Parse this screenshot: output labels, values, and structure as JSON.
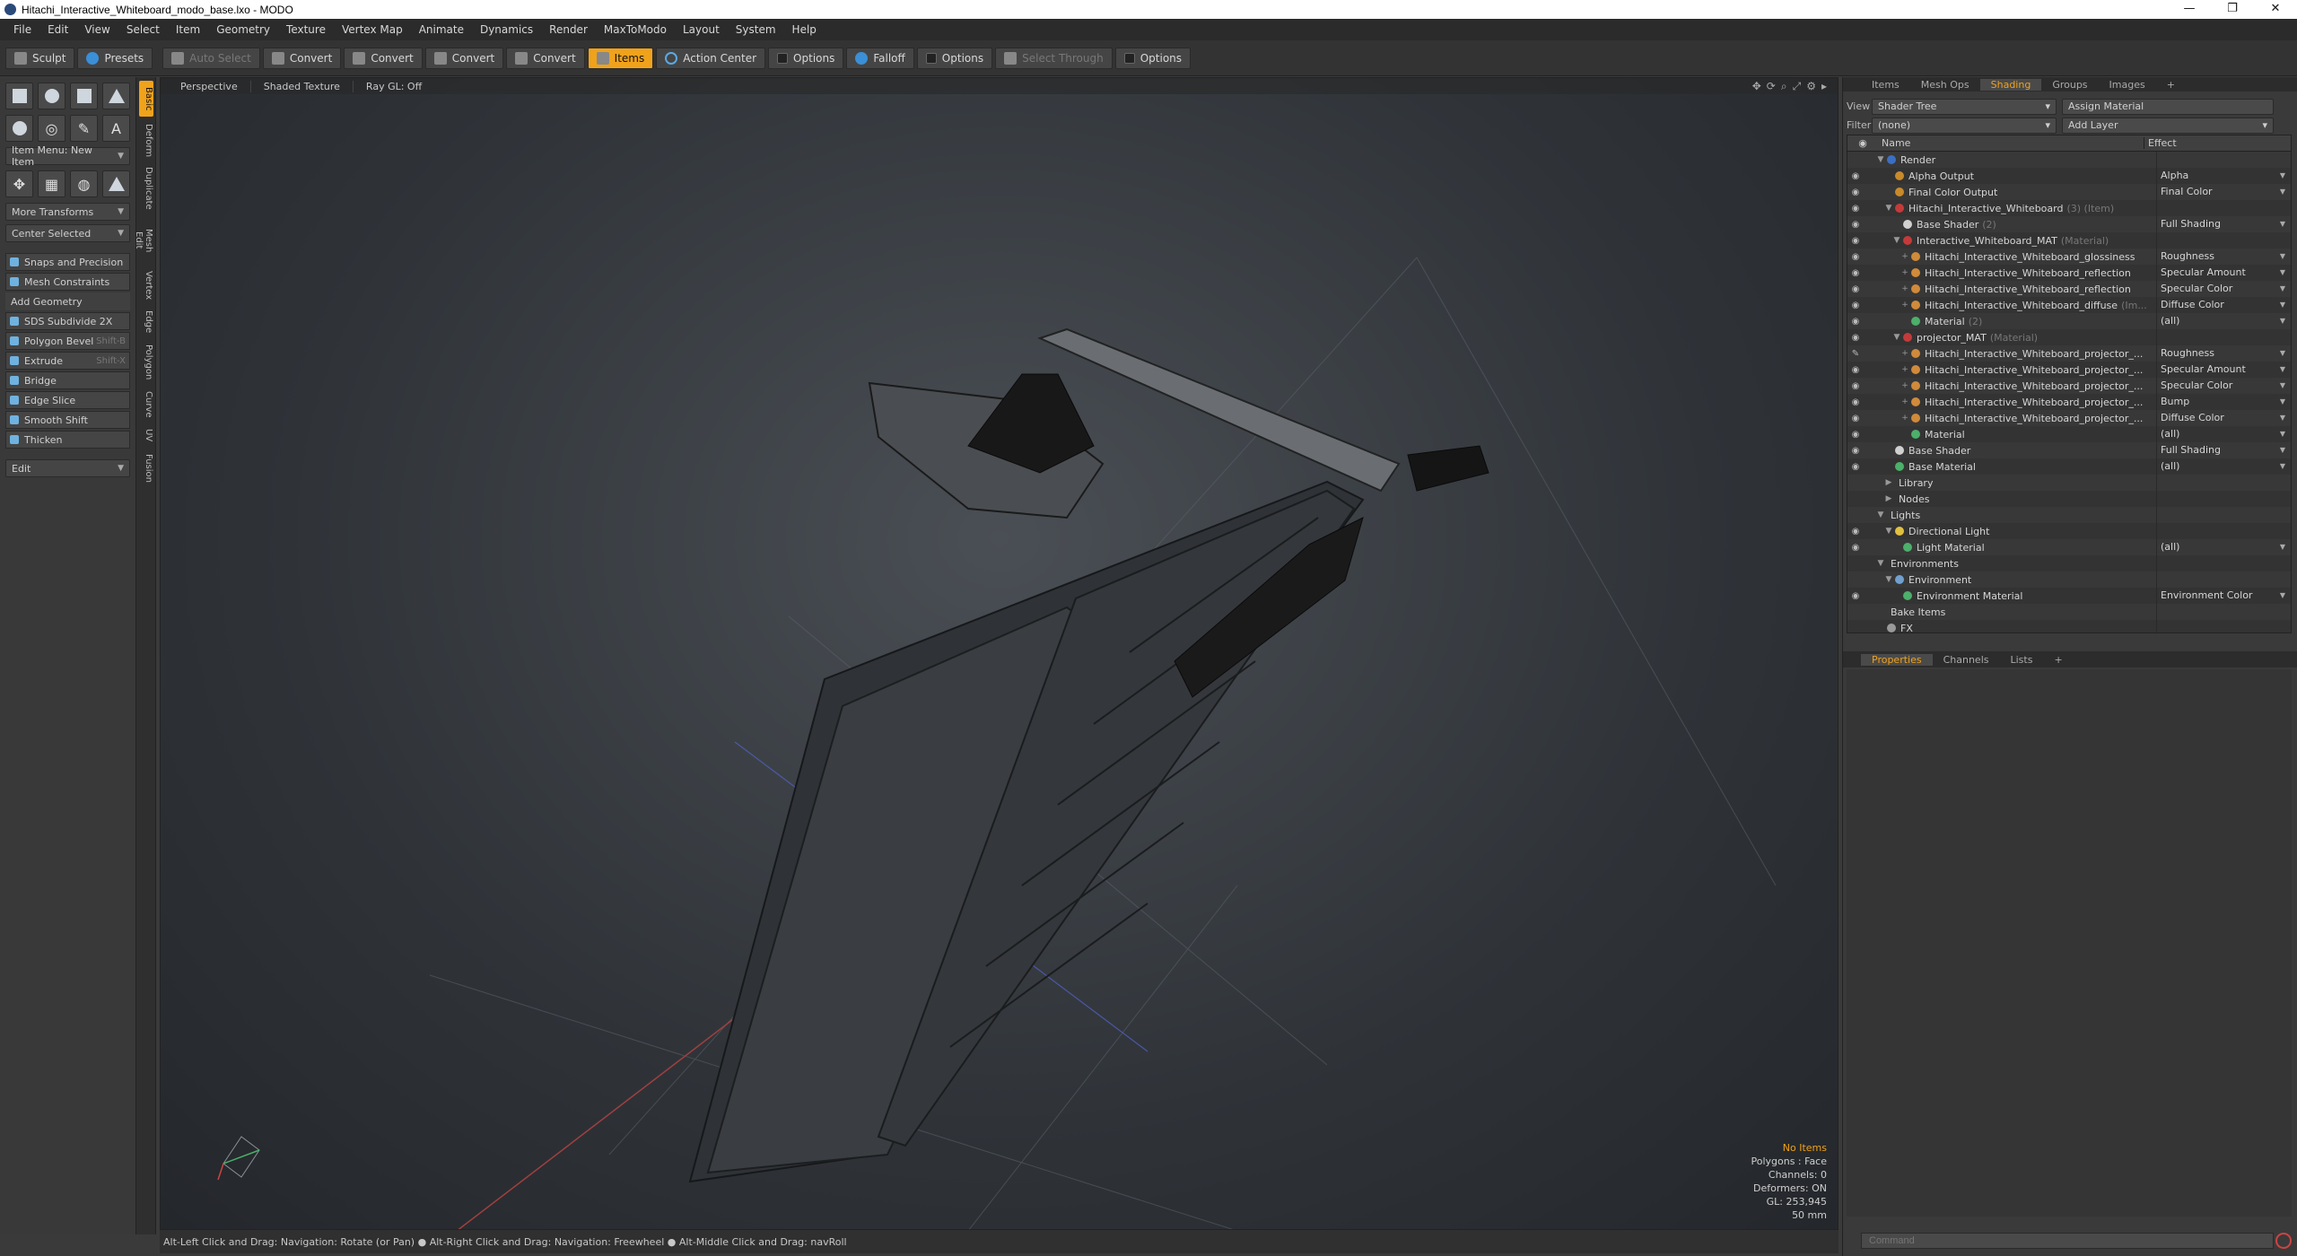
{
  "window": {
    "title": "Hitachi_Interactive_Whiteboard_modo_base.lxo - MODO",
    "controls": [
      "—",
      "❐",
      "✕"
    ]
  },
  "menu": [
    "File",
    "Edit",
    "View",
    "Select",
    "Item",
    "Geometry",
    "Texture",
    "Vertex Map",
    "Animate",
    "Dynamics",
    "Render",
    "MaxToModo",
    "Layout",
    "System",
    "Help"
  ],
  "toolbar": {
    "sculpt": "Sculpt",
    "presets": "Presets",
    "auto_select": "Auto Select",
    "convert1": "Convert",
    "convert2": "Convert",
    "convert3": "Convert",
    "convert4": "Convert",
    "items": "Items",
    "action_center": "Action Center",
    "options1": "Options",
    "falloff": "Falloff",
    "options2": "Options",
    "select_through": "Select Through",
    "options3": "Options"
  },
  "left_panel": {
    "item_menu": "Item Menu: New Item",
    "more_transforms": "More Transforms",
    "center_selected": "Center Selected",
    "snaps": "Snaps and Precision",
    "mesh_constraints": "Mesh Constraints",
    "add_geometry": "Add Geometry",
    "tools": [
      {
        "label": "SDS Subdivide 2X",
        "shortcut": ""
      },
      {
        "label": "Polygon Bevel",
        "shortcut": "Shift-B"
      },
      {
        "label": "Extrude",
        "shortcut": "Shift-X"
      },
      {
        "label": "Bridge",
        "shortcut": ""
      },
      {
        "label": "Edge Slice",
        "shortcut": ""
      },
      {
        "label": "Smooth Shift",
        "shortcut": ""
      },
      {
        "label": "Thicken",
        "shortcut": ""
      }
    ],
    "edit": "Edit"
  },
  "vtabs": [
    "Basic",
    "Deform",
    "Duplicate",
    "Mesh Edit",
    "Vertex",
    "Edge",
    "Polygon",
    "Curve",
    "UV",
    "Fusion"
  ],
  "viewport": {
    "tabs": [
      "Perspective",
      "Shaded Texture",
      "Ray GL: Off"
    ],
    "info": {
      "items": "No Items",
      "polygons": "Polygons : Face",
      "channels": "Channels: 0",
      "deformers": "Deformers: ON",
      "gl": "GL: 253,945",
      "mm": "50 mm"
    }
  },
  "statusbar": "Alt-Left Click and Drag: Navigation: Rotate (or Pan) ● Alt-Right Click and Drag: Navigation: Freewheel ● Alt-Middle Click and Drag: navRoll",
  "right_panel": {
    "tabs": [
      "Items",
      "Mesh Ops",
      "Shading",
      "Groups",
      "Images",
      "+"
    ],
    "view_label": "View",
    "view_value": "Shader Tree",
    "assign_material": "Assign Material",
    "filter_label": "Filter",
    "filter_value": "(none)",
    "add_layer": "Add Layer",
    "col_name": "Name",
    "col_effect": "Effect",
    "tree": [
      {
        "indent": 0,
        "eye": "",
        "tw": "▼",
        "color": "#3a6fc4",
        "name": "Render",
        "sub": "",
        "effect": ""
      },
      {
        "indent": 1,
        "eye": "◉",
        "tw": "",
        "color": "#c98a2a",
        "name": "Alpha Output",
        "sub": "",
        "effect": "Alpha"
      },
      {
        "indent": 1,
        "eye": "◉",
        "tw": "",
        "color": "#c98a2a",
        "name": "Final Color Output",
        "sub": "",
        "effect": "Final Color"
      },
      {
        "indent": 1,
        "eye": "◉",
        "tw": "▼",
        "color": "#c43a3a",
        "name": "Hitachi_Interactive_Whiteboard",
        "sub": "(3) (Item)",
        "effect": ""
      },
      {
        "indent": 2,
        "eye": "◉",
        "tw": "",
        "color": "#d0d0d0",
        "name": "Base Shader",
        "sub": "(2)",
        "effect": "Full Shading"
      },
      {
        "indent": 2,
        "eye": "◉",
        "tw": "▼",
        "color": "#c43a3a",
        "name": "Interactive_Whiteboard_MAT",
        "sub": "(Material)",
        "effect": ""
      },
      {
        "indent": 3,
        "eye": "◉",
        "tw": "+",
        "color": "#d08a3a",
        "name": "Hitachi_Interactive_Whiteboard_glossiness",
        "sub": "",
        "effect": "Roughness"
      },
      {
        "indent": 3,
        "eye": "◉",
        "tw": "+",
        "color": "#d08a3a",
        "name": "Hitachi_Interactive_Whiteboard_reflection",
        "sub": "",
        "effect": "Specular Amount"
      },
      {
        "indent": 3,
        "eye": "◉",
        "tw": "+",
        "color": "#d08a3a",
        "name": "Hitachi_Interactive_Whiteboard_reflection",
        "sub": "",
        "effect": "Specular Color"
      },
      {
        "indent": 3,
        "eye": "◉",
        "tw": "+",
        "color": "#d08a3a",
        "name": "Hitachi_Interactive_Whiteboard_diffuse",
        "sub": "(Im...",
        "effect": "Diffuse Color"
      },
      {
        "indent": 3,
        "eye": "◉",
        "tw": "",
        "color": "#4caf6a",
        "name": "Material",
        "sub": "(2)",
        "effect": "(all)"
      },
      {
        "indent": 2,
        "eye": "◉",
        "tw": "▼",
        "color": "#c43a3a",
        "name": "projector_MAT",
        "sub": "(Material)",
        "effect": ""
      },
      {
        "indent": 3,
        "eye": "✎",
        "tw": "+",
        "color": "#d08a3a",
        "name": "Hitachi_Interactive_Whiteboard_projector_...",
        "sub": "",
        "effect": "Roughness"
      },
      {
        "indent": 3,
        "eye": "◉",
        "tw": "+",
        "color": "#d08a3a",
        "name": "Hitachi_Interactive_Whiteboard_projector_...",
        "sub": "",
        "effect": "Specular Amount"
      },
      {
        "indent": 3,
        "eye": "◉",
        "tw": "+",
        "color": "#d08a3a",
        "name": "Hitachi_Interactive_Whiteboard_projector_...",
        "sub": "",
        "effect": "Specular Color"
      },
      {
        "indent": 3,
        "eye": "◉",
        "tw": "+",
        "color": "#d08a3a",
        "name": "Hitachi_Interactive_Whiteboard_projector_...",
        "sub": "",
        "effect": "Bump"
      },
      {
        "indent": 3,
        "eye": "◉",
        "tw": "+",
        "color": "#d08a3a",
        "name": "Hitachi_Interactive_Whiteboard_projector_...",
        "sub": "",
        "effect": "Diffuse Color"
      },
      {
        "indent": 3,
        "eye": "◉",
        "tw": "",
        "color": "#4caf6a",
        "name": "Material",
        "sub": "",
        "effect": "(all)"
      },
      {
        "indent": 1,
        "eye": "◉",
        "tw": "",
        "color": "#d0d0d0",
        "name": "Base Shader",
        "sub": "",
        "effect": "Full Shading"
      },
      {
        "indent": 1,
        "eye": "◉",
        "tw": "",
        "color": "#4caf6a",
        "name": "Base Material",
        "sub": "",
        "effect": "(all)"
      },
      {
        "indent": 1,
        "eye": "",
        "tw": "▶",
        "color": "",
        "name": "Library",
        "sub": "",
        "effect": ""
      },
      {
        "indent": 1,
        "eye": "",
        "tw": "▶",
        "color": "",
        "name": "Nodes",
        "sub": "",
        "effect": ""
      },
      {
        "indent": 0,
        "eye": "",
        "tw": "▼",
        "color": "",
        "name": "Lights",
        "sub": "",
        "effect": ""
      },
      {
        "indent": 1,
        "eye": "◉",
        "tw": "▼",
        "color": "#e0c040",
        "name": "Directional Light",
        "sub": "",
        "effect": ""
      },
      {
        "indent": 2,
        "eye": "◉",
        "tw": "",
        "color": "#4caf6a",
        "name": "Light Material",
        "sub": "",
        "effect": "(all)"
      },
      {
        "indent": 0,
        "eye": "",
        "tw": "▼",
        "color": "",
        "name": "Environments",
        "sub": "",
        "effect": ""
      },
      {
        "indent": 1,
        "eye": "",
        "tw": "▼",
        "color": "#6fa0d0",
        "name": "Environment",
        "sub": "",
        "effect": ""
      },
      {
        "indent": 2,
        "eye": "◉",
        "tw": "",
        "color": "#4caf6a",
        "name": "Environment Material",
        "sub": "",
        "effect": "Environment Color"
      },
      {
        "indent": 0,
        "eye": "",
        "tw": "",
        "color": "",
        "name": "Bake Items",
        "sub": "",
        "effect": ""
      },
      {
        "indent": 0,
        "eye": "",
        "tw": "",
        "color": "#999999",
        "name": "FX",
        "sub": "",
        "effect": ""
      }
    ],
    "props_tabs": [
      "Properties",
      "Channels",
      "Lists",
      "+"
    ],
    "command_placeholder": "Command"
  }
}
